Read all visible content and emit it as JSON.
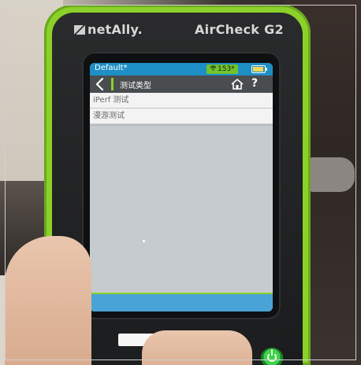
{
  "device": {
    "brand": "netAlly.",
    "model": "AirCheck G2"
  },
  "status_bar": {
    "profile": "Default*",
    "wifi_count": "153*",
    "colors": {
      "bar": "#1e8fc4",
      "wifi_badge": "#70c52b",
      "battery_fill": "#f5d65a"
    }
  },
  "nav_bar": {
    "title": "测试类型",
    "help": "?"
  },
  "list": {
    "items": [
      {
        "label": "iPerf 测试"
      },
      {
        "label": "漫游测试"
      }
    ]
  },
  "colors": {
    "device_shell": "#8bd12a",
    "screen_background": "#c6cbcf",
    "nav_background": "#4a4d4f"
  },
  "icons": {
    "back": "back-icon",
    "home": "home-icon",
    "help": "help-icon",
    "battery": "battery-icon",
    "wifi": "wifi-icon",
    "power": "power-icon"
  }
}
